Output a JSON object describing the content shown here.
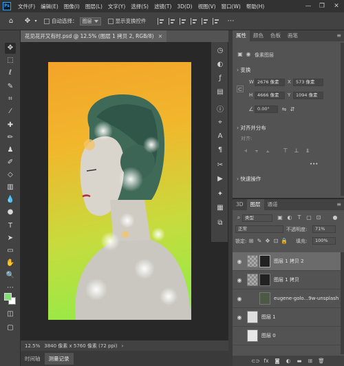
{
  "menubar": {
    "logo": "Ps",
    "items": [
      "文件(F)",
      "编辑(E)",
      "图像(I)",
      "图层(L)",
      "文字(Y)",
      "选择(S)",
      "滤镜(T)",
      "3D(D)",
      "视图(V)",
      "窗口(W)",
      "帮助(H)"
    ],
    "minimize": "—",
    "restore": "❐",
    "close": "✕"
  },
  "optionsbar": {
    "auto_select_label": "自动选择：",
    "auto_select_value": "图层",
    "show_transform_label": "显示变换控件"
  },
  "document": {
    "tab_title": "花见花开又有时.psd @ 12.5% (图层 1 拷贝 2, RGB/8)",
    "tab_close": "×",
    "zoom": "12.5%",
    "size_info": "3840 像素 x 5760 像素 (72 ppi)",
    "status_arrow": "›"
  },
  "bottom_tabs": [
    "时间轴",
    "测量记录"
  ],
  "properties": {
    "tabs": [
      "属性",
      "颜色",
      "色板",
      "画笔"
    ],
    "layer_kind": "像素图层",
    "transform_label": "变换",
    "w_label": "W",
    "w_value": "2676 像素",
    "x_label": "X",
    "x_value": "573 像素",
    "h_label": "H",
    "h_value": "4666 像素",
    "y_label": "Y",
    "y_value": "1094 像素",
    "angle_value": "0.00°",
    "align_label": "对齐并分布",
    "align_sub": "对齐:",
    "more": "•••",
    "quick_actions_label": "快速操作"
  },
  "layers": {
    "tabs": [
      "3D",
      "图层",
      "通道"
    ],
    "filter_type": "类型",
    "blend_mode": "正常",
    "opacity_label": "不透明度:",
    "opacity_value": "71%",
    "lock_label": "锁定:",
    "fill_label": "填充:",
    "fill_value": "100%",
    "rows": [
      {
        "name": "图层 1 拷贝 2",
        "selected": true
      },
      {
        "name": "图层 1 拷贝",
        "selected": false
      },
      {
        "name": "eugene-golo...9w-unsplash",
        "selected": false
      },
      {
        "name": "图层 1",
        "selected": false
      },
      {
        "name": "图层 0",
        "selected": false
      }
    ],
    "bottom_icons": [
      "link-icon",
      "fx-icon",
      "mask-icon",
      "adjustment-icon",
      "group-icon",
      "new-layer-icon",
      "trash-icon"
    ],
    "fx_label": "fx"
  },
  "colors": {
    "foreground": "#7fe06f",
    "background": "#ffffff",
    "canvas_gradient_top": "#f3a42a",
    "canvas_gradient_bottom": "#8ced49"
  }
}
